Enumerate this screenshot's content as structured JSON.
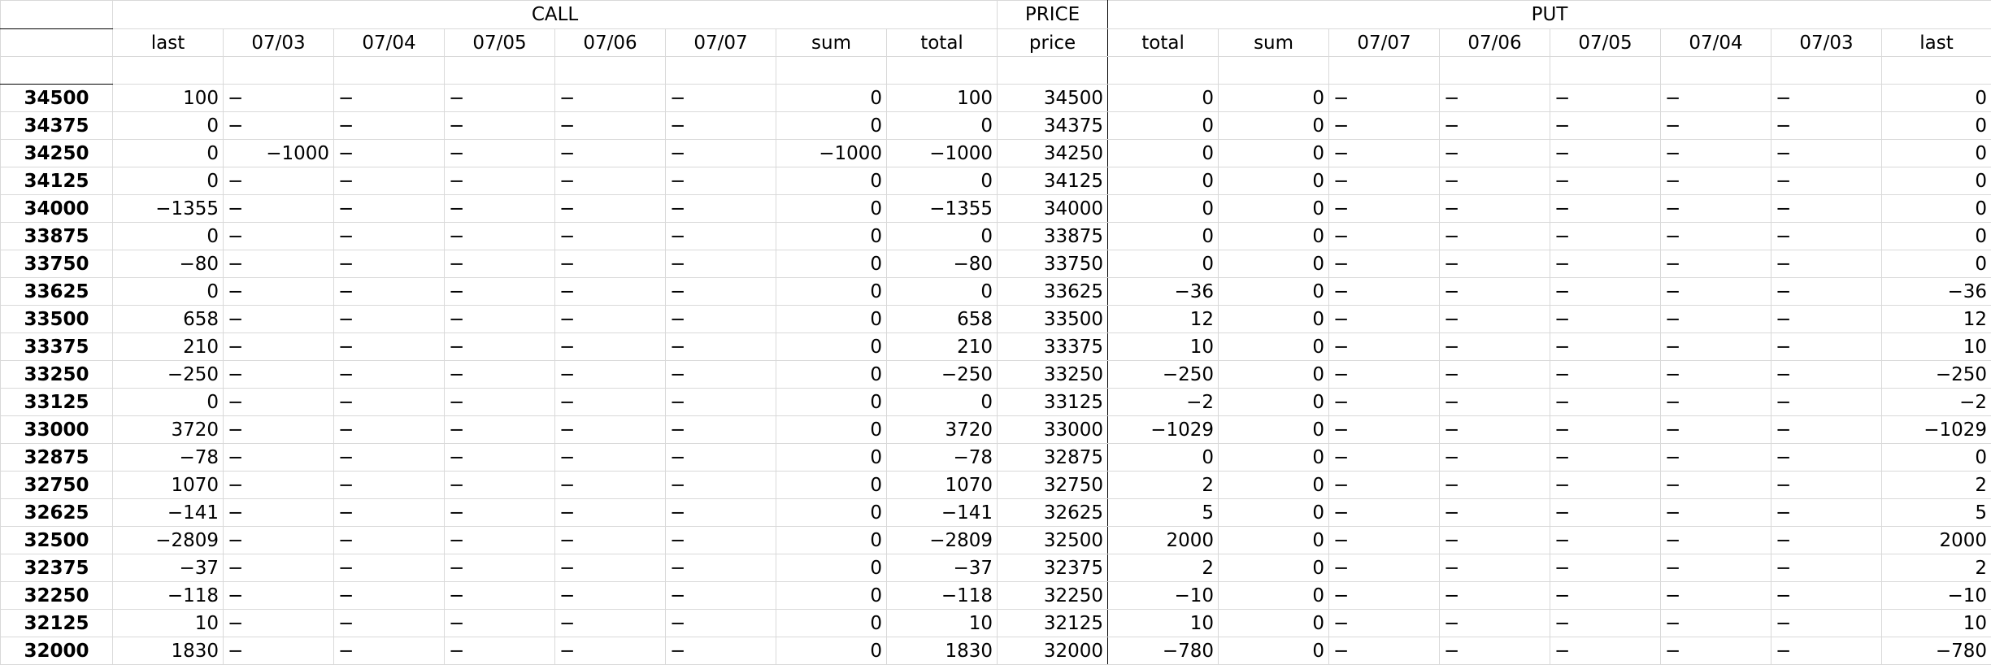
{
  "header_groups": {
    "call": "CALL",
    "price": "PRICE",
    "put": "PUT"
  },
  "columns": [
    "last",
    "07/03",
    "07/04",
    "07/05",
    "07/06",
    "07/07",
    "sum",
    "total",
    "price",
    "total",
    "sum",
    "07/07",
    "07/06",
    "07/05",
    "07/04",
    "07/03",
    "last"
  ],
  "rows": [
    {
      "label": "34500",
      "c_last": "100",
      "c_0703": "−",
      "c_0704": "−",
      "c_0705": "−",
      "c_0706": "−",
      "c_0707": "−",
      "c_sum": "0",
      "c_total": "100",
      "price": "34500",
      "p_total": "0",
      "p_sum": "0",
      "p_0707": "−",
      "p_0706": "−",
      "p_0705": "−",
      "p_0704": "−",
      "p_0703": "−",
      "p_last": "0"
    },
    {
      "label": "34375",
      "c_last": "0",
      "c_0703": "−",
      "c_0704": "−",
      "c_0705": "−",
      "c_0706": "−",
      "c_0707": "−",
      "c_sum": "0",
      "c_total": "0",
      "price": "34375",
      "p_total": "0",
      "p_sum": "0",
      "p_0707": "−",
      "p_0706": "−",
      "p_0705": "−",
      "p_0704": "−",
      "p_0703": "−",
      "p_last": "0"
    },
    {
      "label": "34250",
      "c_last": "0",
      "c_0703": "−1000",
      "c_0704": "−",
      "c_0705": "−",
      "c_0706": "−",
      "c_0707": "−",
      "c_sum": "−1000",
      "c_total": "−1000",
      "price": "34250",
      "p_total": "0",
      "p_sum": "0",
      "p_0707": "−",
      "p_0706": "−",
      "p_0705": "−",
      "p_0704": "−",
      "p_0703": "−",
      "p_last": "0"
    },
    {
      "label": "34125",
      "c_last": "0",
      "c_0703": "−",
      "c_0704": "−",
      "c_0705": "−",
      "c_0706": "−",
      "c_0707": "−",
      "c_sum": "0",
      "c_total": "0",
      "price": "34125",
      "p_total": "0",
      "p_sum": "0",
      "p_0707": "−",
      "p_0706": "−",
      "p_0705": "−",
      "p_0704": "−",
      "p_0703": "−",
      "p_last": "0"
    },
    {
      "label": "34000",
      "c_last": "−1355",
      "c_0703": "−",
      "c_0704": "−",
      "c_0705": "−",
      "c_0706": "−",
      "c_0707": "−",
      "c_sum": "0",
      "c_total": "−1355",
      "price": "34000",
      "p_total": "0",
      "p_sum": "0",
      "p_0707": "−",
      "p_0706": "−",
      "p_0705": "−",
      "p_0704": "−",
      "p_0703": "−",
      "p_last": "0"
    },
    {
      "label": "33875",
      "c_last": "0",
      "c_0703": "−",
      "c_0704": "−",
      "c_0705": "−",
      "c_0706": "−",
      "c_0707": "−",
      "c_sum": "0",
      "c_total": "0",
      "price": "33875",
      "p_total": "0",
      "p_sum": "0",
      "p_0707": "−",
      "p_0706": "−",
      "p_0705": "−",
      "p_0704": "−",
      "p_0703": "−",
      "p_last": "0"
    },
    {
      "label": "33750",
      "c_last": "−80",
      "c_0703": "−",
      "c_0704": "−",
      "c_0705": "−",
      "c_0706": "−",
      "c_0707": "−",
      "c_sum": "0",
      "c_total": "−80",
      "price": "33750",
      "p_total": "0",
      "p_sum": "0",
      "p_0707": "−",
      "p_0706": "−",
      "p_0705": "−",
      "p_0704": "−",
      "p_0703": "−",
      "p_last": "0"
    },
    {
      "label": "33625",
      "c_last": "0",
      "c_0703": "−",
      "c_0704": "−",
      "c_0705": "−",
      "c_0706": "−",
      "c_0707": "−",
      "c_sum": "0",
      "c_total": "0",
      "price": "33625",
      "p_total": "−36",
      "p_sum": "0",
      "p_0707": "−",
      "p_0706": "−",
      "p_0705": "−",
      "p_0704": "−",
      "p_0703": "−",
      "p_last": "−36"
    },
    {
      "label": "33500",
      "c_last": "658",
      "c_0703": "−",
      "c_0704": "−",
      "c_0705": "−",
      "c_0706": "−",
      "c_0707": "−",
      "c_sum": "0",
      "c_total": "658",
      "price": "33500",
      "p_total": "12",
      "p_sum": "0",
      "p_0707": "−",
      "p_0706": "−",
      "p_0705": "−",
      "p_0704": "−",
      "p_0703": "−",
      "p_last": "12"
    },
    {
      "label": "33375",
      "c_last": "210",
      "c_0703": "−",
      "c_0704": "−",
      "c_0705": "−",
      "c_0706": "−",
      "c_0707": "−",
      "c_sum": "0",
      "c_total": "210",
      "price": "33375",
      "p_total": "10",
      "p_sum": "0",
      "p_0707": "−",
      "p_0706": "−",
      "p_0705": "−",
      "p_0704": "−",
      "p_0703": "−",
      "p_last": "10"
    },
    {
      "label": "33250",
      "c_last": "−250",
      "c_0703": "−",
      "c_0704": "−",
      "c_0705": "−",
      "c_0706": "−",
      "c_0707": "−",
      "c_sum": "0",
      "c_total": "−250",
      "price": "33250",
      "p_total": "−250",
      "p_sum": "0",
      "p_0707": "−",
      "p_0706": "−",
      "p_0705": "−",
      "p_0704": "−",
      "p_0703": "−",
      "p_last": "−250"
    },
    {
      "label": "33125",
      "c_last": "0",
      "c_0703": "−",
      "c_0704": "−",
      "c_0705": "−",
      "c_0706": "−",
      "c_0707": "−",
      "c_sum": "0",
      "c_total": "0",
      "price": "33125",
      "p_total": "−2",
      "p_sum": "0",
      "p_0707": "−",
      "p_0706": "−",
      "p_0705": "−",
      "p_0704": "−",
      "p_0703": "−",
      "p_last": "−2"
    },
    {
      "label": "33000",
      "c_last": "3720",
      "c_0703": "−",
      "c_0704": "−",
      "c_0705": "−",
      "c_0706": "−",
      "c_0707": "−",
      "c_sum": "0",
      "c_total": "3720",
      "price": "33000",
      "p_total": "−1029",
      "p_sum": "0",
      "p_0707": "−",
      "p_0706": "−",
      "p_0705": "−",
      "p_0704": "−",
      "p_0703": "−",
      "p_last": "−1029"
    },
    {
      "label": "32875",
      "c_last": "−78",
      "c_0703": "−",
      "c_0704": "−",
      "c_0705": "−",
      "c_0706": "−",
      "c_0707": "−",
      "c_sum": "0",
      "c_total": "−78",
      "price": "32875",
      "p_total": "0",
      "p_sum": "0",
      "p_0707": "−",
      "p_0706": "−",
      "p_0705": "−",
      "p_0704": "−",
      "p_0703": "−",
      "p_last": "0"
    },
    {
      "label": "32750",
      "c_last": "1070",
      "c_0703": "−",
      "c_0704": "−",
      "c_0705": "−",
      "c_0706": "−",
      "c_0707": "−",
      "c_sum": "0",
      "c_total": "1070",
      "price": "32750",
      "p_total": "2",
      "p_sum": "0",
      "p_0707": "−",
      "p_0706": "−",
      "p_0705": "−",
      "p_0704": "−",
      "p_0703": "−",
      "p_last": "2"
    },
    {
      "label": "32625",
      "c_last": "−141",
      "c_0703": "−",
      "c_0704": "−",
      "c_0705": "−",
      "c_0706": "−",
      "c_0707": "−",
      "c_sum": "0",
      "c_total": "−141",
      "price": "32625",
      "p_total": "5",
      "p_sum": "0",
      "p_0707": "−",
      "p_0706": "−",
      "p_0705": "−",
      "p_0704": "−",
      "p_0703": "−",
      "p_last": "5"
    },
    {
      "label": "32500",
      "c_last": "−2809",
      "c_0703": "−",
      "c_0704": "−",
      "c_0705": "−",
      "c_0706": "−",
      "c_0707": "−",
      "c_sum": "0",
      "c_total": "−2809",
      "price": "32500",
      "p_total": "2000",
      "p_sum": "0",
      "p_0707": "−",
      "p_0706": "−",
      "p_0705": "−",
      "p_0704": "−",
      "p_0703": "−",
      "p_last": "2000"
    },
    {
      "label": "32375",
      "c_last": "−37",
      "c_0703": "−",
      "c_0704": "−",
      "c_0705": "−",
      "c_0706": "−",
      "c_0707": "−",
      "c_sum": "0",
      "c_total": "−37",
      "price": "32375",
      "p_total": "2",
      "p_sum": "0",
      "p_0707": "−",
      "p_0706": "−",
      "p_0705": "−",
      "p_0704": "−",
      "p_0703": "−",
      "p_last": "2"
    },
    {
      "label": "32250",
      "c_last": "−118",
      "c_0703": "−",
      "c_0704": "−",
      "c_0705": "−",
      "c_0706": "−",
      "c_0707": "−",
      "c_sum": "0",
      "c_total": "−118",
      "price": "32250",
      "p_total": "−10",
      "p_sum": "0",
      "p_0707": "−",
      "p_0706": "−",
      "p_0705": "−",
      "p_0704": "−",
      "p_0703": "−",
      "p_last": "−10"
    },
    {
      "label": "32125",
      "c_last": "10",
      "c_0703": "−",
      "c_0704": "−",
      "c_0705": "−",
      "c_0706": "−",
      "c_0707": "−",
      "c_sum": "0",
      "c_total": "10",
      "price": "32125",
      "p_total": "10",
      "p_sum": "0",
      "p_0707": "−",
      "p_0706": "−",
      "p_0705": "−",
      "p_0704": "−",
      "p_0703": "−",
      "p_last": "10"
    },
    {
      "label": "32000",
      "c_last": "1830",
      "c_0703": "−",
      "c_0704": "−",
      "c_0705": "−",
      "c_0706": "−",
      "c_0707": "−",
      "c_sum": "0",
      "c_total": "1830",
      "price": "32000",
      "p_total": "−780",
      "p_sum": "0",
      "p_0707": "−",
      "p_0706": "−",
      "p_0705": "−",
      "p_0704": "−",
      "p_0703": "−",
      "p_last": "−780"
    }
  ]
}
